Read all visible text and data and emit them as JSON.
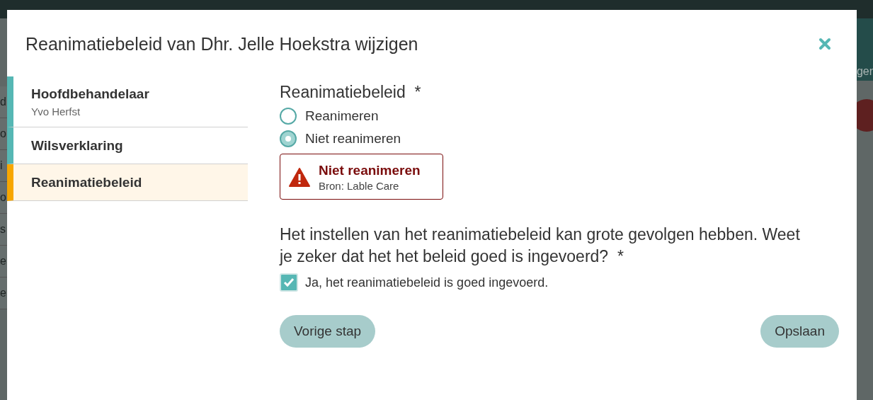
{
  "background": {
    "header_fragment": "ger",
    "side_fragments": [
      "d",
      "o",
      "i",
      "o",
      "s",
      "e",
      "e"
    ]
  },
  "dialog": {
    "title": "Reanimatiebeleid van Dhr. Jelle Hoekstra wijzigen",
    "steps": [
      {
        "label": "Hoofdbehandelaar",
        "sub": "Yvo Herfst",
        "selected": false
      },
      {
        "label": "Wilsverklaring",
        "selected": false
      },
      {
        "label": "Reanimatiebeleid",
        "selected": true
      }
    ],
    "policy": {
      "label": "Reanimatiebeleid",
      "required": "*",
      "options": [
        {
          "label": "Reanimeren",
          "selected": false
        },
        {
          "label": "Niet reanimeren",
          "selected": true
        }
      ]
    },
    "alert": {
      "title": "Niet reanimeren",
      "source": "Bron: Lable Care"
    },
    "confirm": {
      "question": "Het instellen van het reanimatiebeleid kan grote gevolgen hebben. Weet je zeker dat het het beleid goed is ingevoerd?",
      "required": "*",
      "checkbox_label": "Ja, het reanimatiebeleid is goed ingevoerd.",
      "checked": true
    },
    "buttons": {
      "back": "Vorige stap",
      "save": "Opslaan"
    }
  }
}
